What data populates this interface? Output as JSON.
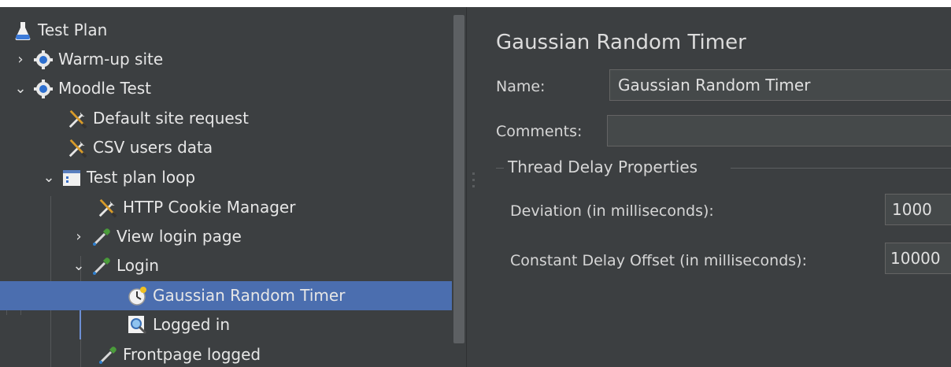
{
  "tree": {
    "items": [
      {
        "label": "Test Plan",
        "icon": "flask-icon",
        "chevron": ""
      },
      {
        "label": "Warm-up site",
        "icon": "gear-icon",
        "chevron": "›"
      },
      {
        "label": "Moodle Test",
        "icon": "gear-icon",
        "chevron": "⌄"
      },
      {
        "label": "Default site request",
        "icon": "wrench-screwdriver-icon",
        "chevron": ""
      },
      {
        "label": "CSV users data",
        "icon": "wrench-screwdriver-icon",
        "chevron": ""
      },
      {
        "label": "Test plan loop",
        "icon": "loop-controller-icon",
        "chevron": "⌄"
      },
      {
        "label": "HTTP Cookie Manager",
        "icon": "wrench-screwdriver-icon",
        "chevron": ""
      },
      {
        "label": "View login page",
        "icon": "pipette-icon",
        "chevron": "›"
      },
      {
        "label": "Login",
        "icon": "pipette-icon",
        "chevron": "⌄"
      },
      {
        "label": "Gaussian Random Timer",
        "icon": "timer-icon",
        "chevron": "",
        "selected": true
      },
      {
        "label": "Logged in",
        "icon": "magnifier-assertion-icon",
        "chevron": ""
      },
      {
        "label": "Frontpage logged",
        "icon": "pipette-icon",
        "chevron": ""
      }
    ]
  },
  "panel": {
    "title": "Gaussian Random Timer",
    "name_label": "Name:",
    "name_value": "Gaussian Random Timer",
    "comments_label": "Comments:",
    "comments_value": "",
    "group_title": "Thread Delay Properties",
    "deviation_label": "Deviation (in milliseconds):",
    "deviation_value": "1000",
    "offset_label": "Constant Delay Offset (in milliseconds):",
    "offset_value": "10000"
  },
  "colors": {
    "background": "#3c3f41",
    "selection": "#4b6eaf",
    "text": "#e6e6e6"
  }
}
